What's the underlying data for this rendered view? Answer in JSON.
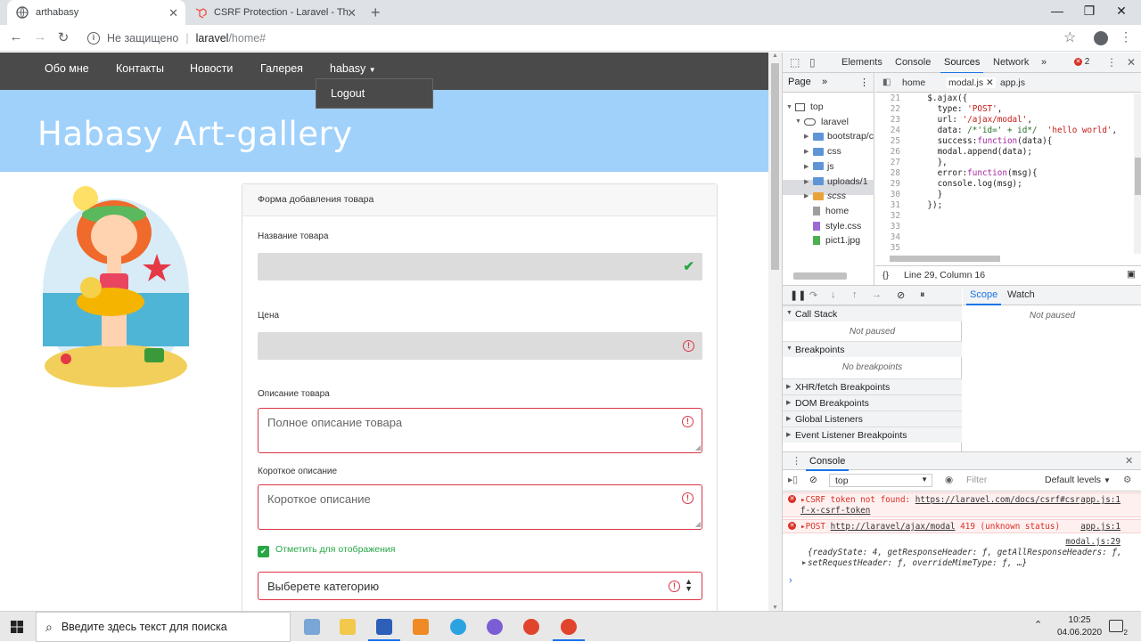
{
  "browser": {
    "tabs": [
      {
        "title": "arthabasy",
        "active": true
      },
      {
        "title": "CSRF Protection - Laravel - The P",
        "active": false
      }
    ],
    "address": {
      "security_text": "Не защищено",
      "host": "laravel",
      "path": "/home#"
    }
  },
  "site": {
    "nav": [
      "Обо мне",
      "Контакты",
      "Новости",
      "Галерея",
      "habasy"
    ],
    "dropdown_item": "Logout",
    "hero_title": "Habasy Art-gallery",
    "form": {
      "header": "Форма добавления товара",
      "name_label": "Название товара",
      "price_label": "Цена",
      "description_label": "Описание товара",
      "description_placeholder": "Полное описание товара",
      "short_label": "Короткое описание",
      "short_placeholder": "Короткое описание",
      "display_checkbox_label": "Отметить для отображения",
      "category_placeholder": "Выберете категорию"
    }
  },
  "devtools": {
    "tabs": [
      "Elements",
      "Console",
      "Sources",
      "Network"
    ],
    "active_tab": "Sources",
    "more": "»",
    "error_count": "2",
    "navigator": {
      "tab": "Page",
      "more": "»",
      "tree": [
        {
          "label": "top",
          "kind": "frame",
          "indent": 0
        },
        {
          "label": "laravel",
          "kind": "cloud",
          "indent": 1
        },
        {
          "label": "bootstrap/c",
          "kind": "folder",
          "indent": 2
        },
        {
          "label": "css",
          "kind": "folder",
          "indent": 2
        },
        {
          "label": "js",
          "kind": "folder",
          "indent": 2
        },
        {
          "label": "uploads/1",
          "kind": "folder",
          "indent": 2
        },
        {
          "label": "scss",
          "kind": "folder-orange",
          "indent": 2
        },
        {
          "label": "home",
          "kind": "file-gray",
          "indent": 2
        },
        {
          "label": "style.css",
          "kind": "file-purple",
          "indent": 2
        },
        {
          "label": "pict1.jpg",
          "kind": "file-green",
          "indent": 2
        }
      ]
    },
    "editor_tabs": [
      "home",
      "modal.js",
      "app.js"
    ],
    "active_editor_tab": "modal.js",
    "line_numbers": [
      "21",
      "22",
      "23",
      "24",
      "25",
      "26",
      "27",
      "28",
      "29",
      "30",
      "31",
      "32",
      "33",
      "34",
      "35",
      "36"
    ],
    "status": "Line 29, Column 16",
    "debugger": {
      "sections": [
        {
          "title": "Call Stack",
          "open": true,
          "body": "Not paused"
        },
        {
          "title": "Breakpoints",
          "open": true,
          "body": "No breakpoints"
        },
        {
          "title": "XHR/fetch Breakpoints",
          "open": false
        },
        {
          "title": "DOM Breakpoints",
          "open": false
        },
        {
          "title": "Global Listeners",
          "open": false
        },
        {
          "title": "Event Listener Breakpoints",
          "open": false
        }
      ],
      "scope_tab": "Scope",
      "watch_tab": "Watch",
      "scope_body": "Not paused"
    },
    "console": {
      "title": "Console",
      "context": "top",
      "filter_placeholder": "Filter",
      "levels": "Default levels",
      "messages": [
        {
          "type": "error",
          "text": "CSRF token not found: ",
          "link": "https://laravel.com/docs/csrf#csr",
          "cont": "f-x-csrf-token",
          "source": "app.js:1"
        },
        {
          "type": "error",
          "text": "POST ",
          "link": "http://laravel/ajax/modal",
          "status": " 419 (unknown status)",
          "source": "app.js:1"
        },
        {
          "type": "log",
          "source": "modal.js:29",
          "line1": "{readyState: 4, getResponseHeader: ƒ, getAllResponseHeaders: ƒ,",
          "line2": "setRequestHeader: ƒ, overrideMimeType: ƒ, …}"
        }
      ]
    }
  },
  "taskbar": {
    "search_placeholder": "Введите здесь текст для поиска",
    "time": "10:25",
    "date": "04.06.2020",
    "notifications": "2"
  },
  "colors": {
    "site_nav": "#4a4a4a",
    "hero": "#9fd1fb",
    "error_red": "#dc3545",
    "success_green": "#28a745",
    "devtools_accent": "#1a73e8"
  }
}
